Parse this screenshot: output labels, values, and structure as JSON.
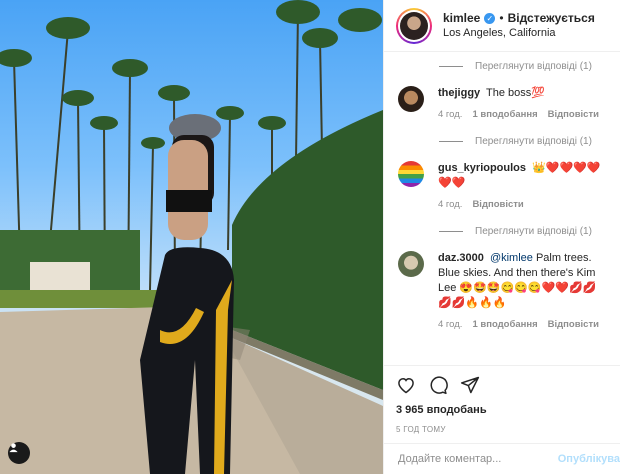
{
  "post": {
    "username": "kimlee",
    "follow_status": "Відстежується",
    "separator": "•",
    "location": "Los Angeles, California"
  },
  "comments": [
    {
      "replies_label": "Переглянути відповіді (1)"
    },
    {
      "username": "thejiggy",
      "text": "The boss💯",
      "time": "4 год.",
      "likes": "1 вподобання",
      "reply": "Відповісти",
      "replies_label": "Переглянути відповіді (1)"
    },
    {
      "username": "gus_kyriopoulos",
      "text": "👑❤️❤️❤️❤️❤️❤️",
      "time": "4 год.",
      "reply": "Відповісти",
      "replies_label": "Переглянути відповіді (1)"
    },
    {
      "username": "daz.3000",
      "mention": "@kimlee",
      "text": "Palm trees. Blue skies. And then there's Kim Lee 😍🤩🤩😋😋😋❤️❤️💋💋💋💋🔥🔥🔥",
      "time": "4 год.",
      "likes": "1 вподобання",
      "reply": "Відповісти"
    }
  ],
  "actions": {
    "icons": [
      "heart-icon",
      "comment-icon",
      "share-icon"
    ],
    "likes_count": "3 965 вподобань",
    "posted": "5 ГОД ТОМУ"
  },
  "composer": {
    "placeholder": "Додайте коментар...",
    "post_label": "Опублікува"
  },
  "colors": {
    "link_blue": "#00376b",
    "verified_blue": "#3897f0",
    "muted": "#8e8e8e",
    "post_disabled": "#b2dffc"
  }
}
